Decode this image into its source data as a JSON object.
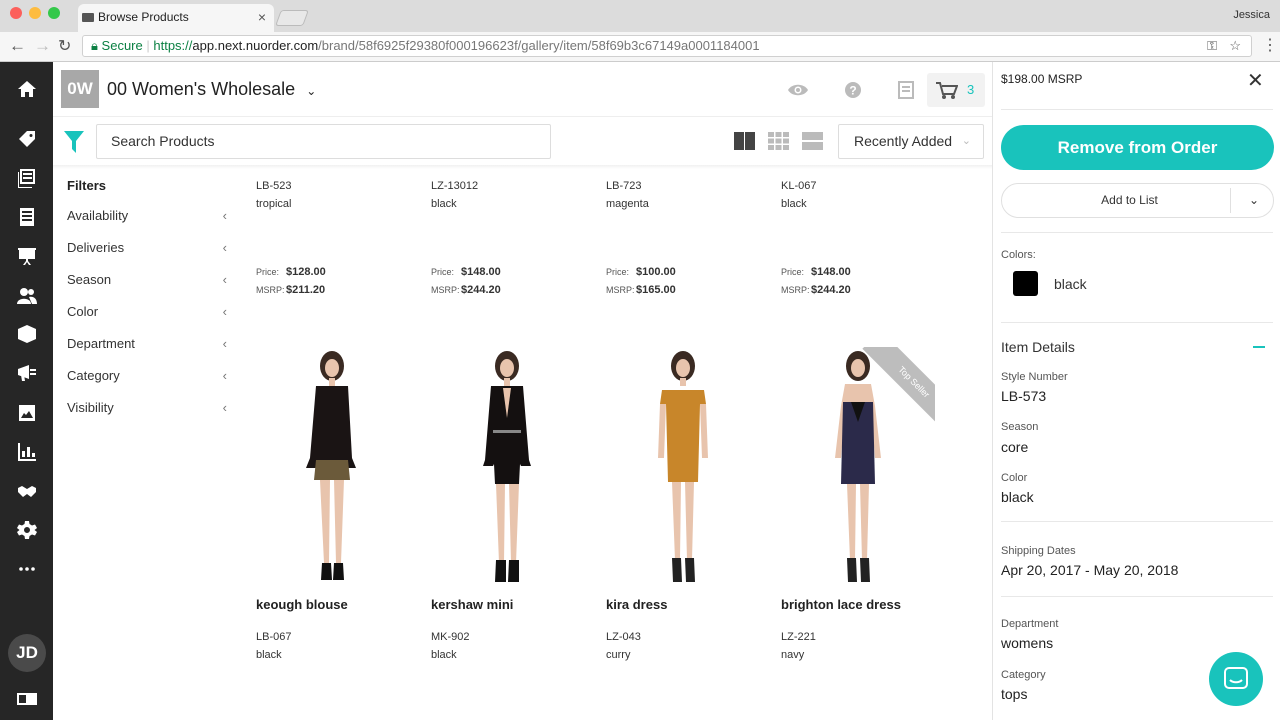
{
  "browser": {
    "tab_title": "Browse Products",
    "tab_close": "×",
    "user": "Jessica",
    "secure_label": "Secure",
    "url_scheme": "https://",
    "url_host": "app.next.nuorder.com",
    "url_path": "/brand/58f6925f29380f000196623f/gallery/item/58f69b3c67149a0001184001",
    "colors": {
      "close": "#fc605b",
      "minimize": "#fdbc40",
      "maximize": "#34c84a"
    }
  },
  "sidebar": {
    "icons": [
      "home-icon",
      "tag-icon",
      "catalog-icon",
      "orders-icon",
      "presentation-icon",
      "customers-icon",
      "inventory-icon",
      "marketing-icon",
      "media-icon",
      "reports-icon",
      "handshake-icon",
      "settings-icon",
      "more-icon"
    ],
    "avatar": "JD"
  },
  "header": {
    "brand_logo": "0W",
    "brand_name": "00 Women's Wholesale",
    "cart_count": "3",
    "accent": "#19c3bc"
  },
  "toolbar": {
    "search_placeholder": "Search Products",
    "sort_label": "Recently Added"
  },
  "filters": {
    "title": "Filters",
    "items": [
      "Availability",
      "Deliveries",
      "Season",
      "Color",
      "Department",
      "Category",
      "Visibility"
    ]
  },
  "top_row": [
    {
      "sku": "LB-523",
      "color": "tropical",
      "price_label": "Price:",
      "price": "$128.00",
      "msrp_label": "MSRP:",
      "msrp": "$211.20"
    },
    {
      "sku": "LZ-13012",
      "color": "black",
      "price_label": "Price:",
      "price": "$148.00",
      "msrp_label": "MSRP:",
      "msrp": "$244.20"
    },
    {
      "sku": "LB-723",
      "color": "magenta",
      "price_label": "Price:",
      "price": "$100.00",
      "msrp_label": "MSRP:",
      "msrp": "$165.00"
    },
    {
      "sku": "KL-067",
      "color": "black",
      "price_label": "Price:",
      "price": "$148.00",
      "msrp_label": "MSRP:",
      "msrp": "$244.20"
    }
  ],
  "products": [
    {
      "name": "keough blouse",
      "sku": "LB-067",
      "color": "black"
    },
    {
      "name": "kershaw mini",
      "sku": "MK-902",
      "color": "black"
    },
    {
      "name": "kira dress",
      "sku": "LZ-043",
      "color": "curry"
    },
    {
      "name": "brighton lace dress",
      "sku": "LZ-221",
      "color": "navy"
    }
  ],
  "ribbon": "Top Seller",
  "panel": {
    "msrp": "$198.00 MSRP",
    "close": "✕",
    "remove_button": "Remove from Order",
    "add_to_list": "Add to List",
    "colors_label": "Colors:",
    "color_name": "black",
    "details_heading": "Item Details",
    "style_label": "Style Number",
    "style_value": "LB-573",
    "season_label": "Season",
    "season_value": "core",
    "color_label": "Color",
    "color_value": "black",
    "shipping_label": "Shipping Dates",
    "shipping_value": "Apr 20, 2017 - May 20, 2018",
    "department_label": "Department",
    "department_value": "womens",
    "category_label": "Category",
    "category_value": "tops"
  }
}
